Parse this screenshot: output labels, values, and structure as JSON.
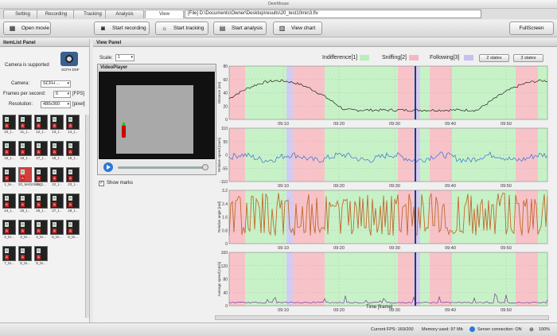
{
  "window": {
    "title": "DeerMouse"
  },
  "tabs": [
    "Setting",
    "Recording",
    "Tracking",
    "Analysis",
    "View"
  ],
  "path": {
    "text": "[File]  D:\\Documents\\Owner\\Desktop\\results\\20_test10min3.flv"
  },
  "toolbar": {
    "open_movie": "Open movie",
    "start_recording": "Start recording",
    "start_tracking": "Start tracking",
    "start_analysis": "Start analysis",
    "view_chart": "View chart",
    "fullscreen": "FullScreen"
  },
  "left_panel": {
    "title": "ItemList Panel",
    "camera_status": "Camera is supported",
    "camera_model": "SCFH DSF",
    "camera_label": "Camera:",
    "camera_value": "SCFH ...",
    "fps_label": "Frames per second:",
    "fps_value": "6",
    "fps_unit": "[FPS]",
    "res_label": "Resolution:",
    "res_value": "480x360",
    "res_unit": "[pixel]",
    "thumbs": [
      "10_t...",
      "11_t...",
      "12_t...",
      "13_t...",
      "14_t...",
      "15_t...",
      "16_t...",
      "17_t...",
      "18_t...",
      "19_t...",
      "1_te...",
      "20_test10min3",
      "21_t...",
      "22_t...",
      "23_t...",
      "24_t...",
      "25_t...",
      "26_t...",
      "27_t...",
      "28_t...",
      "2_te...",
      "3_te...",
      "4_te...",
      "5_te...",
      "6_te...",
      "7_te...",
      "8_te...",
      "9_te..."
    ]
  },
  "view_panel": {
    "title": "View Panel",
    "scale_label": "Scale:",
    "scale_value": "1",
    "video_title": "VideoPlayer",
    "show_marks": "Show marks",
    "legend": [
      {
        "label": "Indifference[1]",
        "color": "#b8efb8"
      },
      {
        "label": "Sniffing[2]",
        "color": "#f4b8c0"
      },
      {
        "label": "Following[3]",
        "color": "#c8c0ef"
      }
    ],
    "state_buttons": [
      "2 states",
      "3 states"
    ],
    "x_axis_title": "Time [frame]"
  },
  "chart_data": [
    {
      "type": "line",
      "ylabel": "Distance [cm]",
      "yticks": [
        "0",
        "20",
        "40",
        "60",
        "80"
      ],
      "ylim": [
        0,
        80
      ],
      "xticks": [
        "09:10",
        "09:20",
        "09:30",
        "09:40",
        "09:50"
      ]
    },
    {
      "type": "line",
      "ylabel": "Relative speed [cm/s]",
      "yticks": [
        "-110",
        "-55",
        "0",
        "55",
        "110"
      ],
      "ylim": [
        -110,
        110
      ],
      "xticks": [
        "09:10",
        "09:20",
        "09:30",
        "09:40",
        "09:50"
      ]
    },
    {
      "type": "line",
      "ylabel": "Relative angle [rad]",
      "yticks": [
        "0",
        "0.8",
        "1.6",
        "2.4",
        "3.2"
      ],
      "ylim": [
        0,
        3.2
      ],
      "xticks": [
        "09:10",
        "09:20",
        "09:30",
        "09:40",
        "09:50"
      ]
    },
    {
      "type": "line",
      "ylabel": "Average speed [cm/s]",
      "yticks": [
        "0",
        "40",
        "80",
        "120",
        "160"
      ],
      "ylim": [
        0,
        160
      ],
      "xticks": [
        "09:10",
        "09:20",
        "09:30",
        "09:40",
        "09:50"
      ]
    }
  ],
  "status": {
    "fps": "Current FPS: 169/200",
    "memory": "Memory used: 97 Mb",
    "server": "Server connection: ON",
    "zoom": "100%"
  },
  "colors": {
    "indifference": "#c7f2c7",
    "sniffing": "#f7c3c9",
    "following": "#d2ccf3",
    "cursor": "#101040"
  }
}
